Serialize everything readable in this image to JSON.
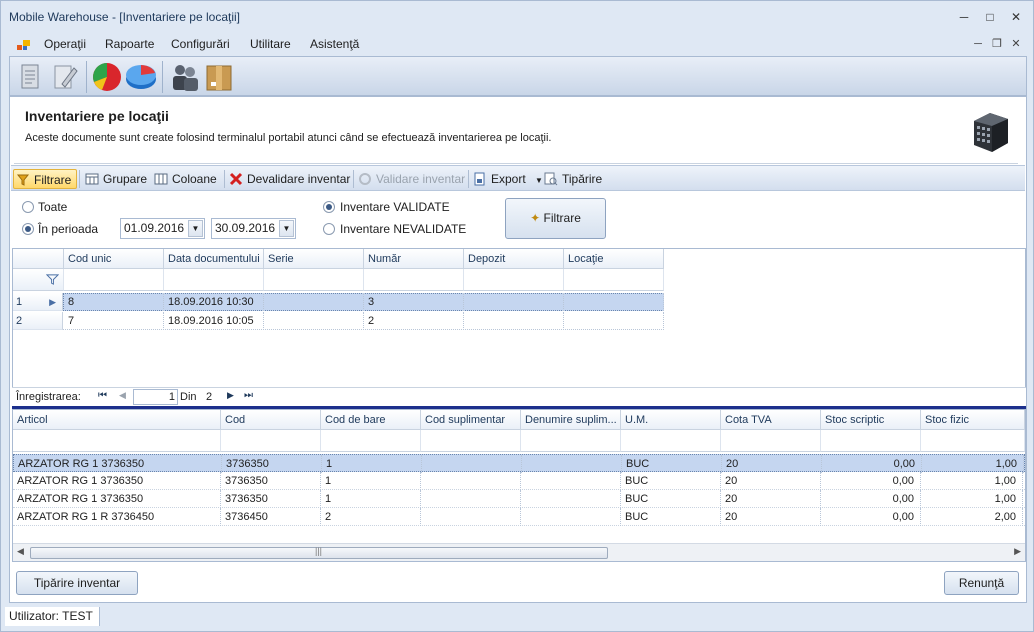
{
  "window": {
    "title": "Mobile Warehouse - [Inventariere pe locaţii]"
  },
  "menu": {
    "items": [
      "Operaţii",
      "Rapoarte",
      "Configurări",
      "Utilitare",
      "Asistenţă"
    ]
  },
  "toolbar": {
    "icons": [
      "document-icon",
      "edit-document-icon",
      "pie-chart-icon",
      "database-chart-icon",
      "users-icon",
      "package-icon"
    ]
  },
  "header": {
    "title": "Inventariere pe locaţii",
    "description": "Aceste documente sunt create folosind terminalul portabil atunci când se efectuează inventarierea pe locaţii."
  },
  "filterbar": {
    "filter": "Filtrare",
    "group": "Grupare",
    "columns": "Coloane",
    "invalidate": "Devalidare inventar",
    "validate": "Validare inventar",
    "export": "Export",
    "print": "Tipărire"
  },
  "filters": {
    "all": "Toate",
    "period": "În perioada",
    "date_from": "01.09.2016",
    "date_to": "30.09.2016",
    "validated": "Inventare VALIDATE",
    "not_validated": "Inventare NEVALIDATE",
    "filter_button": "Filtrare",
    "selected_range": "period",
    "selected_state": "validated"
  },
  "documents_grid": {
    "columns": [
      "Cod unic",
      "Data documentului",
      "Serie",
      "Număr",
      "Depozit",
      "Locaţie"
    ],
    "rows": [
      {
        "num": "1",
        "cod_unic": "8",
        "data": "18.09.2016 10:30",
        "serie": "",
        "numar": "3",
        "depozit": "",
        "locatie": ""
      },
      {
        "num": "2",
        "cod_unic": "7",
        "data": "18.09.2016 10:05",
        "serie": "",
        "numar": "2",
        "depozit": "",
        "locatie": ""
      }
    ]
  },
  "navigator": {
    "label": "Înregistrarea:",
    "current": "1",
    "of_label": "Din",
    "total": "2"
  },
  "items_grid": {
    "columns": [
      "Articol",
      "Cod",
      "Cod de bare",
      "Cod suplimentar",
      "Denumire suplim...",
      "U.M.",
      "Cota TVA",
      "Stoc scriptic",
      "Stoc fizic"
    ],
    "rows": [
      {
        "articol": "ARZATOR RG 1 3736350",
        "cod": "3736350",
        "cod_bare": "1",
        "cod_supl": "",
        "den_supl": "",
        "um": "BUC",
        "tva": "20",
        "scriptic": "0,00",
        "fizic": "1,00"
      },
      {
        "articol": "ARZATOR RG 1 3736350",
        "cod": "3736350",
        "cod_bare": "1",
        "cod_supl": "",
        "den_supl": "",
        "um": "BUC",
        "tva": "20",
        "scriptic": "0,00",
        "fizic": "1,00"
      },
      {
        "articol": "ARZATOR RG 1 3736350",
        "cod": "3736350",
        "cod_bare": "1",
        "cod_supl": "",
        "den_supl": "",
        "um": "BUC",
        "tva": "20",
        "scriptic": "0,00",
        "fizic": "1,00"
      },
      {
        "articol": "ARZATOR RG 1 R 3736450",
        "cod": "3736450",
        "cod_bare": "2",
        "cod_supl": "",
        "den_supl": "",
        "um": "BUC",
        "tva": "20",
        "scriptic": "0,00",
        "fizic": "2,00"
      }
    ]
  },
  "footer": {
    "print_inventory": "Tipărire inventar",
    "cancel": "Renunţă"
  },
  "status": {
    "user": "Utilizator: TEST"
  },
  "colors": {
    "accent": "#1c2f8c",
    "selection": "#c5d6f0",
    "highlight": "#ffd86b"
  }
}
